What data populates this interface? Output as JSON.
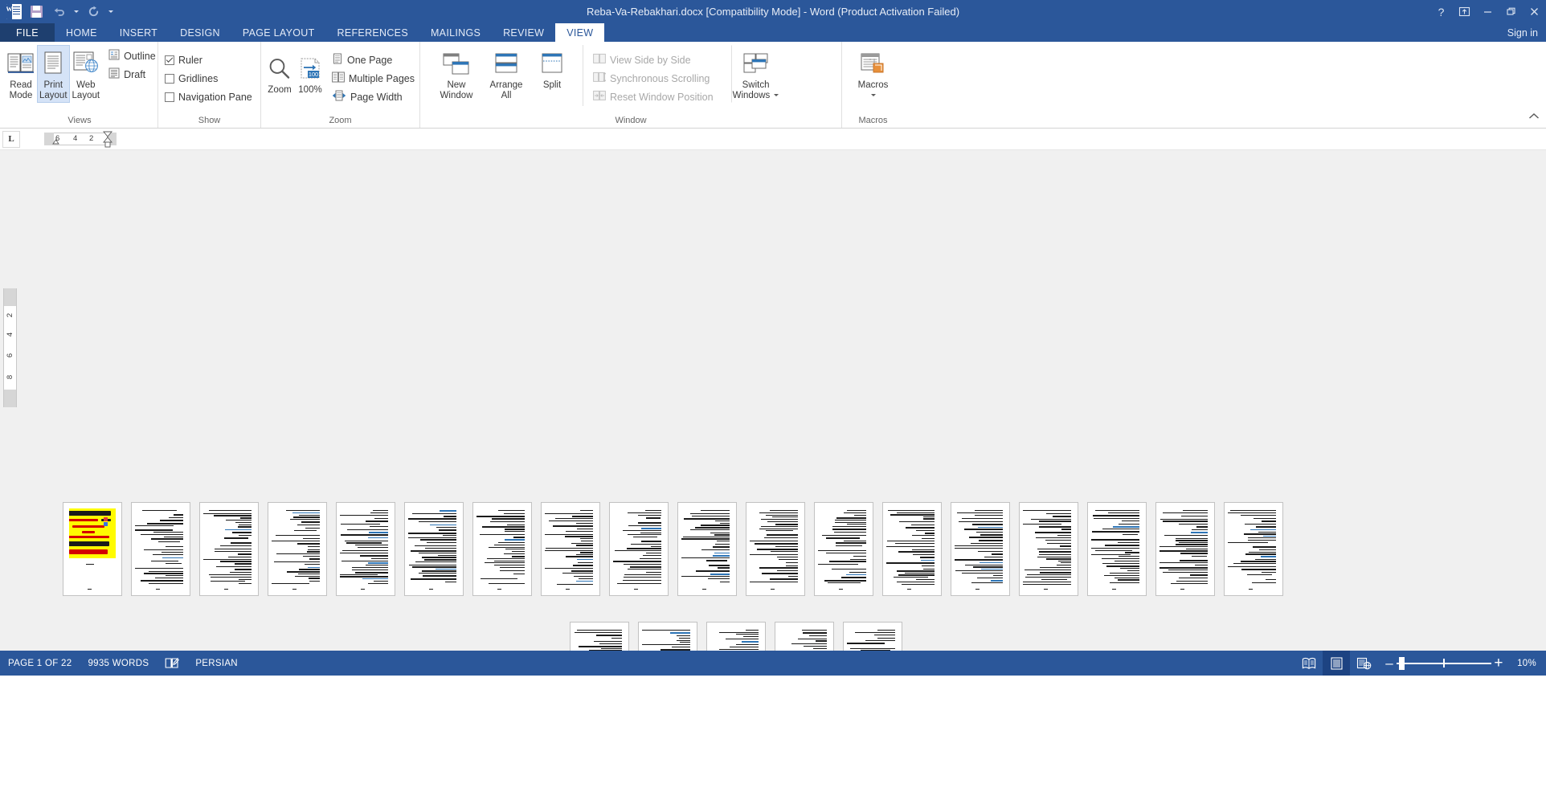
{
  "window": {
    "title": "Reba-Va-Rebakhari.docx [Compatibility Mode] - Word (Product Activation Failed)",
    "help_label": "?",
    "ribbon_display_label": "⬆",
    "minimize_label": "–",
    "restore_label": "❐",
    "close_label": "✕",
    "signin_label": "Sign in"
  },
  "quick_access": {
    "app_letter": "W",
    "save_title": "Save",
    "undo_title": "Undo",
    "redo_title": "Repeat",
    "customize_title": "Customize Quick Access Toolbar"
  },
  "tabs": [
    {
      "label": "FILE",
      "active": false,
      "file": true
    },
    {
      "label": "HOME",
      "active": false
    },
    {
      "label": "INSERT",
      "active": false
    },
    {
      "label": "DESIGN",
      "active": false
    },
    {
      "label": "PAGE LAYOUT",
      "active": false
    },
    {
      "label": "REFERENCES",
      "active": false
    },
    {
      "label": "MAILINGS",
      "active": false
    },
    {
      "label": "REVIEW",
      "active": false
    },
    {
      "label": "VIEW",
      "active": true
    }
  ],
  "ribbon": {
    "groups": [
      {
        "name": "Views",
        "label": "Views"
      },
      {
        "name": "Show",
        "label": "Show"
      },
      {
        "name": "Zoom",
        "label": "Zoom"
      },
      {
        "name": "Window",
        "label": "Window"
      },
      {
        "name": "Macros",
        "label": "Macros"
      }
    ],
    "views": {
      "read_mode": {
        "line1": "Read",
        "line2": "Mode",
        "selected": false
      },
      "print_layout": {
        "line1": "Print",
        "line2": "Layout",
        "selected": true
      },
      "web_layout": {
        "line1": "Web",
        "line2": "Layout",
        "selected": false
      },
      "outline": "Outline",
      "draft": "Draft"
    },
    "show": {
      "ruler": {
        "label": "Ruler",
        "checked": true
      },
      "gridlines": {
        "label": "Gridlines",
        "checked": false
      },
      "navigation_pane": {
        "label": "Navigation Pane",
        "checked": false
      }
    },
    "zoom": {
      "zoom": "Zoom",
      "one_hundred": "100%",
      "badge": "100",
      "one_page": "One Page",
      "multiple_pages": "Multiple Pages",
      "page_width": "Page Width"
    },
    "window": {
      "new_window": {
        "line1": "New",
        "line2": "Window"
      },
      "arrange_all": {
        "line1": "Arrange",
        "line2": "All"
      },
      "split": {
        "line1": "Split",
        "line2": ""
      },
      "view_side_by_side": {
        "label": "View Side by Side",
        "disabled": true
      },
      "synchronous_scrolling": {
        "label": "Synchronous Scrolling",
        "disabled": true
      },
      "reset_window_position": {
        "label": "Reset Window Position",
        "disabled": true
      },
      "switch_windows": {
        "line1": "Switch",
        "line2": "Windows"
      }
    },
    "macros": {
      "macros": {
        "line1": "Macros",
        "line2": ""
      }
    },
    "collapse_title": "Collapse the Ribbon"
  },
  "ruler": {
    "tab_stop_label": "L",
    "horizontal_ticks": [
      "6",
      "4",
      "2"
    ],
    "vertical_ticks": [
      "2",
      "4",
      "6",
      "8"
    ]
  },
  "document": {
    "page_count_visible": 22,
    "first_page_ad": {
      "title": "تحقیق آنلاین",
      "site": "Tahghighonline.ir",
      "line1": "مرجع دانلـــود",
      "line2": "فایل",
      "line3": "ورد-پی دی اف - پاورپوینت",
      "line4": "با کمترین قیمت بازار",
      "phone": "09981366624",
      "whatsapp": "واتساپ"
    },
    "row1_pages": 18,
    "row2_pages": 5
  },
  "statusbar": {
    "page_indicator": "PAGE 1 OF 22",
    "word_count": "9935 WORDS",
    "proofing_title": "Proofing errors",
    "language": "PERSIAN",
    "view_read_mode_title": "Read Mode",
    "view_print_layout_title": "Print Layout",
    "view_web_layout_title": "Web Layout",
    "zoom_out_label": "–",
    "zoom_in_label": "+",
    "zoom_level": "10%"
  },
  "colors": {
    "word_blue": "#2b579a",
    "file_tab_blue": "#1e3f6f",
    "accent_icon_blue": "#2e75b6",
    "selection_blue": "#d5e3f7",
    "doc_background": "#f0f0f0",
    "ad_yellow": "#fffb00",
    "ad_red": "#d40000",
    "macro_orange": "#e8903a"
  }
}
